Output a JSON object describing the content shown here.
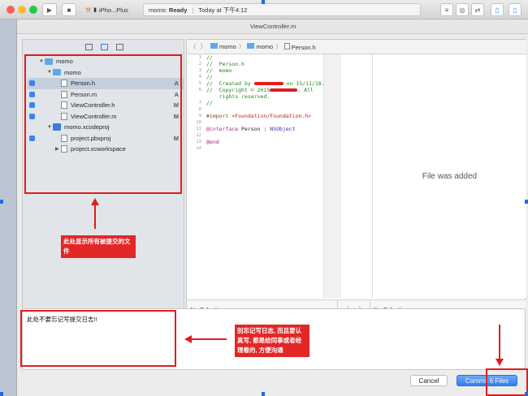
{
  "toolbar": {
    "scheme_label": "iPho...Plus",
    "status_project": "momo:",
    "status_state": "Ready",
    "status_time": "Today at 下午4:12"
  },
  "sheet": {
    "title": "ViewController.m"
  },
  "navigator": {
    "tree": [
      {
        "label": "momo",
        "indent": 0,
        "kind": "project-folder",
        "checked": false,
        "status": "",
        "selected": false
      },
      {
        "label": "momo",
        "indent": 1,
        "kind": "folder",
        "checked": false,
        "status": "",
        "selected": false
      },
      {
        "label": "Person.h",
        "indent": 2,
        "kind": "file",
        "checked": true,
        "status": "A",
        "selected": true
      },
      {
        "label": "Person.m",
        "indent": 2,
        "kind": "file",
        "checked": true,
        "status": "A",
        "selected": false
      },
      {
        "label": "ViewController.h",
        "indent": 2,
        "kind": "file",
        "checked": true,
        "status": "M",
        "selected": false
      },
      {
        "label": "ViewController.m",
        "indent": 2,
        "kind": "file",
        "checked": true,
        "status": "M",
        "selected": false
      },
      {
        "label": "momo.xcodeproj",
        "indent": 1,
        "kind": "project",
        "checked": false,
        "status": "",
        "selected": false
      },
      {
        "label": "project.pbxproj",
        "indent": 2,
        "kind": "file",
        "checked": true,
        "status": "M",
        "selected": false
      },
      {
        "label": "project.xcworkspace",
        "indent": 2,
        "kind": "workspace",
        "checked": false,
        "status": "",
        "selected": false
      }
    ]
  },
  "editor": {
    "breadcrumb": [
      "momo",
      "momo",
      "Person.h"
    ],
    "line_numbers": [
      "1",
      "2",
      "3",
      "4",
      "5",
      "6",
      "",
      "7",
      "8",
      "9",
      "10",
      "11",
      "12",
      "13",
      "14"
    ],
    "right_pane_text": "File was added",
    "footer_left": "No Selection",
    "footer_right": "No Selection"
  },
  "commit": {
    "message": "此处不要忘记写提交日志!!"
  },
  "buttons": {
    "cancel": "Cancel",
    "commit": "Commit 6 Files"
  },
  "annotations": {
    "files_note": "此处显示所有被提交的文件",
    "log_note": "别忘记写日志, 而且要认真写, 都是给同事或者经理看的, 方便沟通"
  },
  "colors": {
    "annotation_red": "#e11d1d",
    "accent_blue": "#2f7ff0"
  }
}
